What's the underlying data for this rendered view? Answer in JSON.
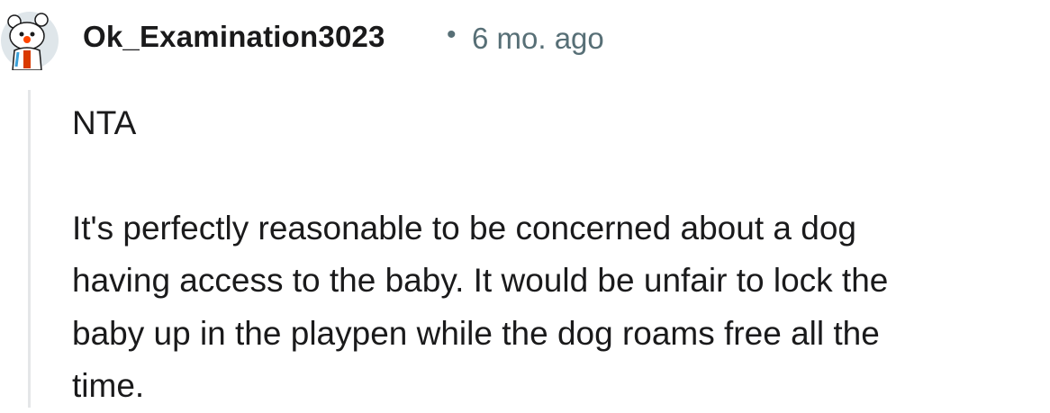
{
  "comment": {
    "author": "Ok_Examination3023",
    "separator": "•",
    "timestamp": "6 mo. ago",
    "avatar_icon": "snoo-avatar-icon",
    "body": {
      "paragraphs": [
        {
          "lines": [
            "NTA"
          ]
        },
        {
          "lines": [
            "It's perfectly reasonable to be concerned about a dog",
            "having access to the baby. It would be unfair to lock the",
            "baby up in the playpen while the dog roams free all the",
            "time."
          ]
        }
      ]
    }
  },
  "colors": {
    "text": "#1a1a1b",
    "meta": "#576f76",
    "thread_line": "#e4e6e8"
  }
}
